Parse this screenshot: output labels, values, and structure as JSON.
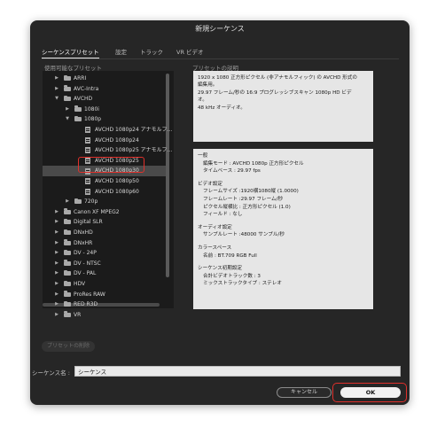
{
  "dialog": {
    "title": "新規シーケンス"
  },
  "tabs": [
    {
      "label": "シーケンスプリセット",
      "active": true
    },
    {
      "label": "設定",
      "active": false
    },
    {
      "label": "トラック",
      "active": false
    },
    {
      "label": "VR ビデオ",
      "active": false
    }
  ],
  "presets_label": "使用可能なプリセット",
  "description_label": "プリセットの説明",
  "tree": [
    {
      "label": "ARRI",
      "type": "folder",
      "expanded": false
    },
    {
      "label": "AVC-Intra",
      "type": "folder",
      "expanded": false
    },
    {
      "label": "AVCHD",
      "type": "folder",
      "expanded": true
    },
    {
      "label": "1080i",
      "type": "folder",
      "expanded": false
    },
    {
      "label": "1080p",
      "type": "folder",
      "expanded": true
    },
    {
      "label": "AVCHD 1080p24 アナモルフ...",
      "type": "preset"
    },
    {
      "label": "AVCHD 1080p24",
      "type": "preset"
    },
    {
      "label": "AVCHD 1080p25 アナモルフ...",
      "type": "preset"
    },
    {
      "label": "AVCHD 1080p25",
      "type": "preset"
    },
    {
      "label": "AVCHD 1080p30",
      "type": "preset",
      "selected": true
    },
    {
      "label": "AVCHD 1080p50",
      "type": "preset"
    },
    {
      "label": "AVCHD 1080p60",
      "type": "preset"
    },
    {
      "label": "720p",
      "type": "folder",
      "expanded": false
    },
    {
      "label": "Canon XF MPEG2",
      "type": "folder",
      "expanded": false
    },
    {
      "label": "Digital SLR",
      "type": "folder",
      "expanded": false
    },
    {
      "label": "DNxHD",
      "type": "folder",
      "expanded": false
    },
    {
      "label": "DNxHR",
      "type": "folder",
      "expanded": false
    },
    {
      "label": "DV - 24P",
      "type": "folder",
      "expanded": false
    },
    {
      "label": "DV - NTSC",
      "type": "folder",
      "expanded": false
    },
    {
      "label": "DV - PAL",
      "type": "folder",
      "expanded": false
    },
    {
      "label": "HDV",
      "type": "folder",
      "expanded": false
    },
    {
      "label": "ProRes RAW",
      "type": "folder",
      "expanded": false
    },
    {
      "label": "RED R3D",
      "type": "folder",
      "expanded": false
    },
    {
      "label": "VR",
      "type": "folder",
      "expanded": false
    }
  ],
  "description": {
    "lines": [
      "1920 x 1080 正方形ピクセル (非アナモルフィック) の AVCHD 形式の",
      "編集用。",
      "29.97 フレーム/秒の 16:9 プログレッシブスキャン 1080p HD ビデ",
      "オ。",
      "48 kHz オーディオ。"
    ]
  },
  "details": {
    "general_title": "一般",
    "edit_mode": "編集モード : AVCHD 1080p 正方形ピクセル",
    "timebase": "タイムベース : 29.97 fps",
    "video_title": "ビデオ設定",
    "frame_size": "フレームサイズ :1920横1080縦 (1.0000)",
    "frame_rate": "フレームレート :29.97 フレーム/秒",
    "pixel_aspect": "ピクセル縦横比 : 正方形ピクセル (1.0)",
    "field": "フィールド : なし",
    "audio_title": "オーディオ設定",
    "sample_rate": "サンプルレート :48000 サンプル/秒",
    "color_title": "カラースペース",
    "color_name": "名前 : BT.709 RGB Full",
    "seq_title": "シーケンス初期設定",
    "video_tracks": "合計ビデオトラック数 : 3",
    "mix_track": "ミックストラックタイプ : ステレオ"
  },
  "delete_preset_label": "プリセットの削除",
  "sequence_name_label": "シーケンス名 :",
  "sequence_name_value": "シーケンス",
  "cancel_label": "キャンセル",
  "ok_label": "OK"
}
